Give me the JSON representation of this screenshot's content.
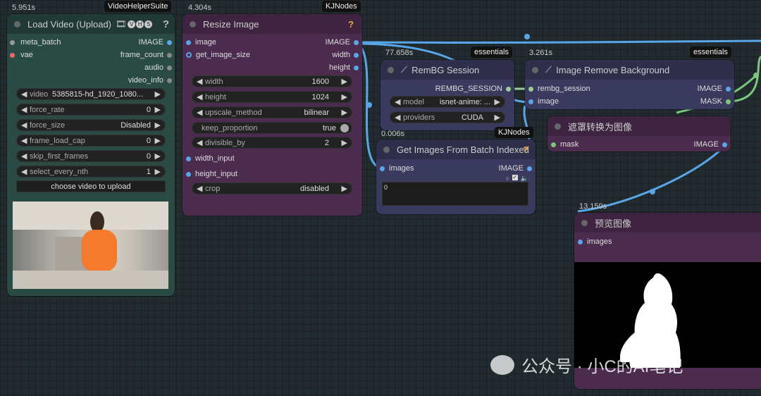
{
  "load_video": {
    "time": "5.951s",
    "tag": "VideoHelperSuite",
    "title": "Load Video (Upload)",
    "badges": [
      "V",
      "H",
      "S"
    ],
    "help": "?",
    "inputs": [
      "meta_batch",
      "vae"
    ],
    "outputs": [
      "IMAGE",
      "frame_count",
      "audio",
      "video_info"
    ],
    "widgets": [
      {
        "label": "video",
        "value": "5385815-hd_1920_1080..."
      },
      {
        "label": "force_rate",
        "value": "0"
      },
      {
        "label": "force_size",
        "value": "Disabled"
      },
      {
        "label": "frame_load_cap",
        "value": "0"
      },
      {
        "label": "skip_first_frames",
        "value": "0"
      },
      {
        "label": "select_every_nth",
        "value": "1"
      }
    ],
    "upload_button": "choose video to upload"
  },
  "resize": {
    "time": "4.304s",
    "tag": "KJNodes",
    "title": "Resize Image",
    "help": "?",
    "inputs": [
      "image",
      "get_image_size"
    ],
    "outputs": [
      "IMAGE",
      "width",
      "height"
    ],
    "widgets": [
      {
        "label": "width",
        "value": "1600"
      },
      {
        "label": "height",
        "value": "1024"
      },
      {
        "label": "upscale_method",
        "value": "bilinear"
      },
      {
        "label": "keep_proportion",
        "value": "true"
      },
      {
        "label": "divisible_by",
        "value": "2"
      }
    ],
    "extra_inputs": [
      "width_input",
      "height_input"
    ],
    "crop": {
      "label": "crop",
      "value": "disabled"
    }
  },
  "rembg_session": {
    "time": "77.658s",
    "tag": "essentials",
    "title": "RemBG Session",
    "output": "REMBG_SESSION",
    "widgets": [
      {
        "label": "model",
        "value": "isnet-anime: ..."
      },
      {
        "label": "providers",
        "value": "CUDA"
      }
    ]
  },
  "remove_bg": {
    "time": "3.261s",
    "tag": "essentials",
    "title": "Image Remove Background",
    "inputs": [
      "rembg_session",
      "image"
    ],
    "outputs": [
      "IMAGE",
      "MASK"
    ]
  },
  "get_images": {
    "time": "0.006s",
    "tag": "KJNodes",
    "title": "Get Images From Batch Indexed",
    "help": "?",
    "input": "images",
    "output": "IMAGE",
    "text_value": "0"
  },
  "mask_to_image": {
    "title": "遮罩转换为图像",
    "input": "mask",
    "output": "IMAGE"
  },
  "preview": {
    "time": "13.159s",
    "title": "预览图像",
    "input": "images"
  },
  "watermark": {
    "text": "公众号 · 小C的AI笔记"
  },
  "colors": {
    "green_node": "#2a4a44",
    "purple_node": "#4b2c4f",
    "blue_node": "#3a3a5e",
    "link_blue": "#58a6e8",
    "link_green": "#7ac87a"
  }
}
